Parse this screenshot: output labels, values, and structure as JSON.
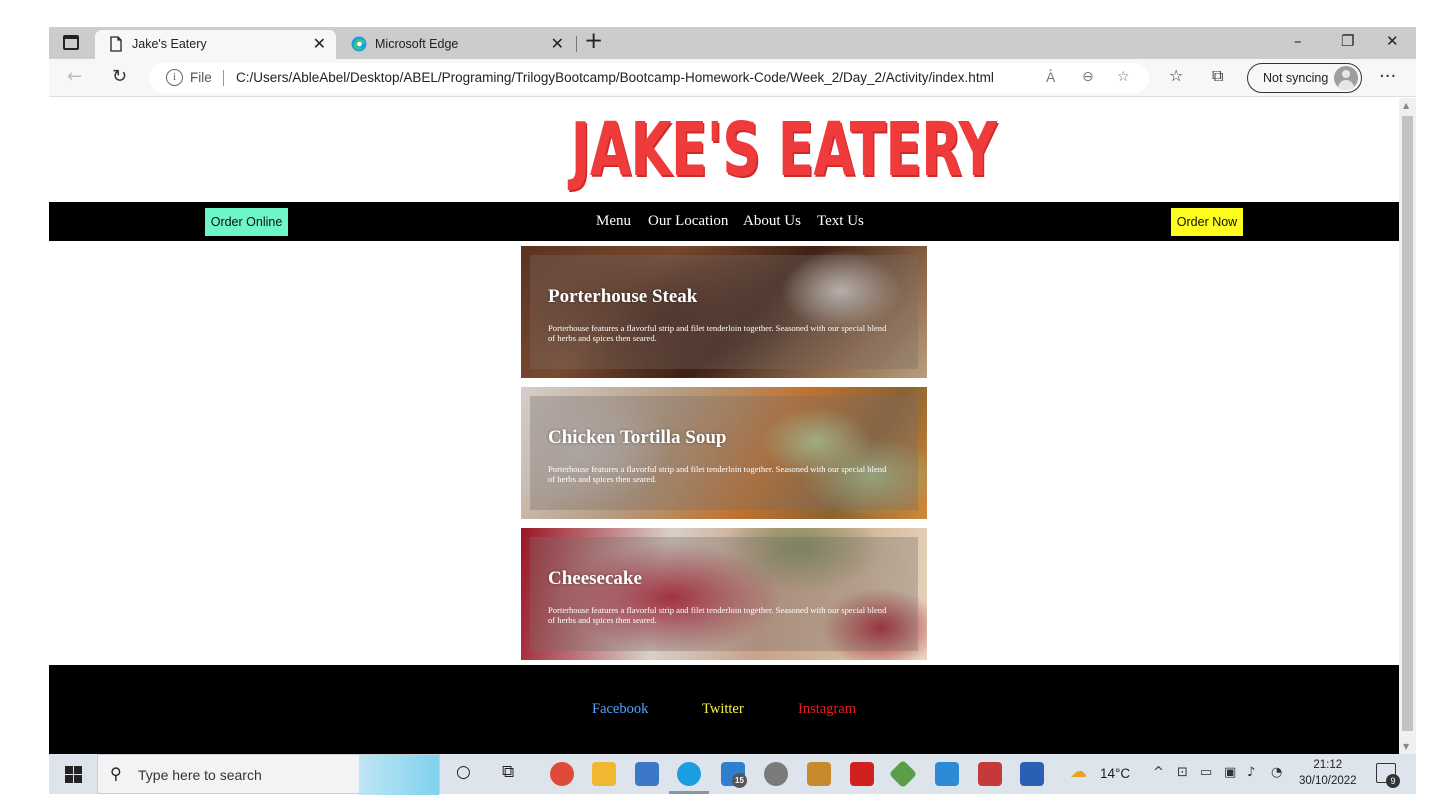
{
  "browser": {
    "tabs": [
      {
        "title": "Jake's Eatery",
        "active": true
      },
      {
        "title": "Microsoft Edge",
        "active": false
      }
    ],
    "address": {
      "prefix": "File",
      "url": "C:/Users/AbleAbel/Desktop/ABEL/Programing/TrilogyBootcamp/Bootcamp-Homework-Code/Week_2/Day_2/Activity/index.html"
    },
    "sync_label": "Not syncing"
  },
  "site": {
    "logo_text": "JAKE'S EATERY",
    "nav": {
      "order_online": "Order Online",
      "links": [
        "Menu",
        "Our Location",
        "About Us",
        "Text Us"
      ],
      "order_now": "Order Now"
    },
    "cards": [
      {
        "title": "Porterhouse Steak",
        "description": "Porterhouse features a flavorful strip and filet tenderloin together. Seasoned with our special blend of herbs and spices then seared."
      },
      {
        "title": "Chicken Tortilla Soup",
        "description": "Porterhouse features a flavorful strip and filet tenderloin together. Seasoned with our special blend of herbs and spices then seared."
      },
      {
        "title": "Cheesecake",
        "description": "Porterhouse features a flavorful strip and filet tenderloin together. Seasoned with our special blend of herbs and spices then seared."
      }
    ],
    "footer": {
      "links": [
        {
          "label": "Facebook",
          "color": "#4fa8ff"
        },
        {
          "label": "Twitter",
          "color": "#f7f34a"
        },
        {
          "label": "Instagram",
          "color": "#e81c1c"
        }
      ]
    },
    "colors": {
      "logo": "#ef3b3b",
      "order_online_bg": "#6ef5c8",
      "order_now_bg": "#fffd1f",
      "bar_bg": "#000000"
    }
  },
  "taskbar": {
    "search_placeholder": "Type here to search",
    "mail_badge": "15",
    "weather": "14°C",
    "time": "21:12",
    "date": "30/10/2022",
    "notifications": "9"
  }
}
